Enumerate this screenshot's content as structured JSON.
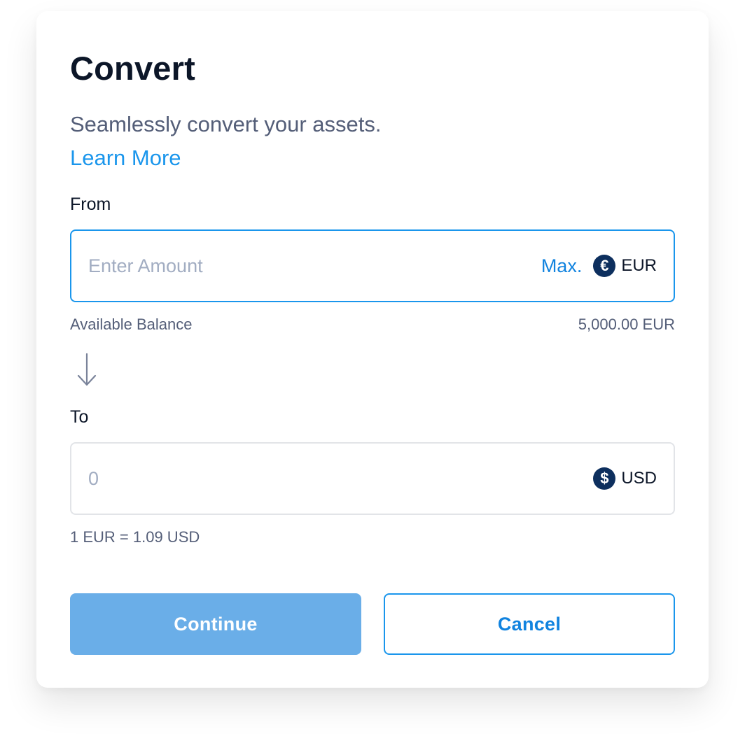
{
  "dialog": {
    "title": "Convert",
    "subtitle": "Seamlessly convert your assets.",
    "learn_more": "Learn More"
  },
  "from": {
    "label": "From",
    "placeholder": "Enter Amount",
    "value": "",
    "max_label": "Max.",
    "currency": {
      "code": "EUR",
      "icon": "euro-icon",
      "symbol": "€"
    },
    "balance_label": "Available Balance",
    "balance_value": "5,000.00 EUR"
  },
  "direction_icon": "arrow-down-icon",
  "to": {
    "label": "To",
    "value": "0",
    "currency": {
      "code": "USD",
      "icon": "dollar-icon",
      "symbol": "$"
    }
  },
  "rate": "1 EUR = 1.09 USD",
  "actions": {
    "continue_label": "Continue",
    "cancel_label": "Cancel"
  },
  "colors": {
    "accent": "#1a96ec",
    "link": "#1183df",
    "primary_disabled": "#6aaee8",
    "currency_icon_bg": "#0d2f5e",
    "title_text": "#0c1628",
    "secondary_text": "#545e78",
    "placeholder_text": "#a2adc2"
  }
}
